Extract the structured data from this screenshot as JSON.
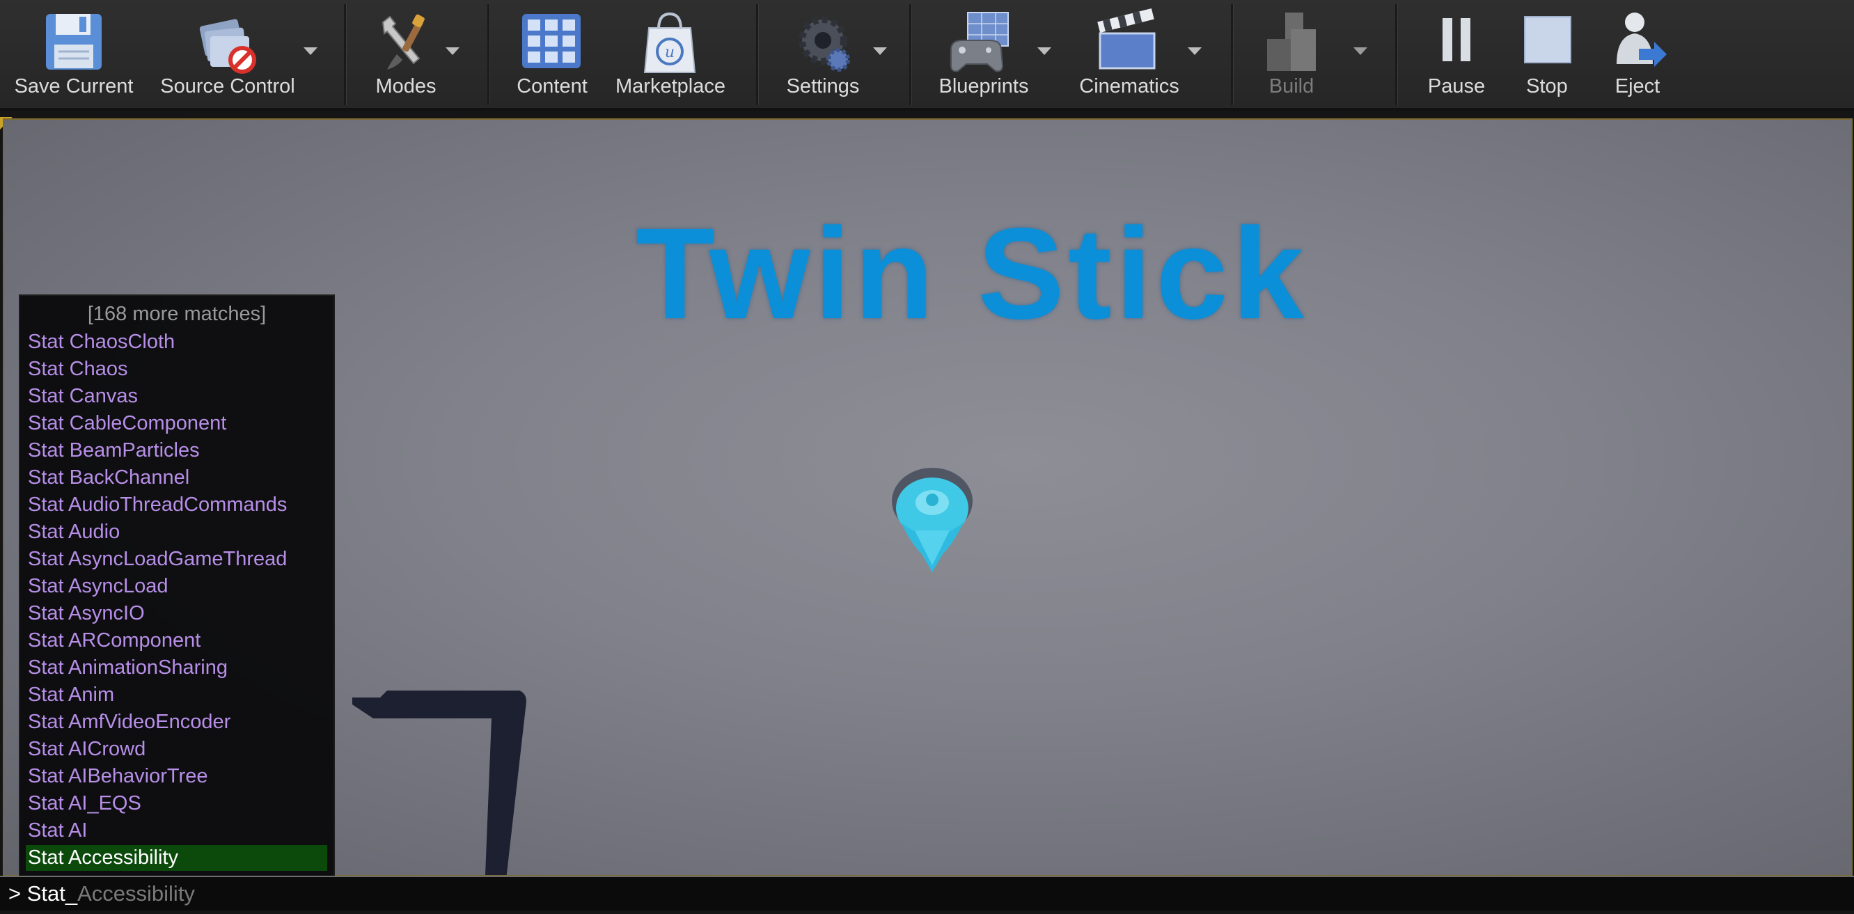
{
  "toolbar": {
    "items": [
      {
        "label": "Save Current",
        "icon": "floppy-disk-icon",
        "has_dropdown": false,
        "enabled": true
      },
      {
        "label": "Source Control",
        "icon": "source-control-icon",
        "has_dropdown": true,
        "enabled": true
      },
      {
        "label": "Modes",
        "icon": "wrench-brush-icon",
        "has_dropdown": true,
        "enabled": true
      },
      {
        "label": "Content",
        "icon": "content-grid-icon",
        "has_dropdown": false,
        "enabled": true
      },
      {
        "label": "Marketplace",
        "icon": "shopping-bag-icon",
        "has_dropdown": false,
        "enabled": true
      },
      {
        "label": "Settings",
        "icon": "gears-icon",
        "has_dropdown": true,
        "enabled": true
      },
      {
        "label": "Blueprints",
        "icon": "gamepad-icon",
        "has_dropdown": true,
        "enabled": true
      },
      {
        "label": "Cinematics",
        "icon": "clapperboard-icon",
        "has_dropdown": true,
        "enabled": true
      },
      {
        "label": "Build",
        "icon": "build-blocks-icon",
        "has_dropdown": true,
        "enabled": false
      },
      {
        "label": "Pause",
        "icon": "pause-icon",
        "has_dropdown": false,
        "enabled": true
      },
      {
        "label": "Stop",
        "icon": "stop-icon",
        "has_dropdown": false,
        "enabled": true
      },
      {
        "label": "Eject",
        "icon": "eject-icon",
        "has_dropdown": false,
        "enabled": true
      }
    ]
  },
  "viewport": {
    "title": "Twin Stick"
  },
  "console": {
    "more_matches": "[168 more matches]",
    "suggestions": [
      "Stat ChaosCloth",
      "Stat Chaos",
      "Stat Canvas",
      "Stat CableComponent",
      "Stat BeamParticles",
      "Stat BackChannel",
      "Stat AudioThreadCommands",
      "Stat Audio",
      "Stat AsyncLoadGameThread",
      "Stat AsyncLoad",
      "Stat AsyncIO",
      "Stat ARComponent",
      "Stat AnimationSharing",
      "Stat Anim",
      "Stat AmfVideoEncoder",
      "Stat AICrowd",
      "Stat AIBehaviorTree",
      "Stat AI_EQS",
      "Stat AI",
      "Stat Accessibility"
    ],
    "selected_index": 19,
    "prompt": ">",
    "typed": "Stat_",
    "autocomplete_hint": "Accessibility"
  },
  "colors": {
    "title_blue": "#0a8fd8",
    "suggestion_text": "#b78fe8",
    "selected_bg": "#0c4a0c",
    "viewport_border": "#7d6a2f"
  }
}
